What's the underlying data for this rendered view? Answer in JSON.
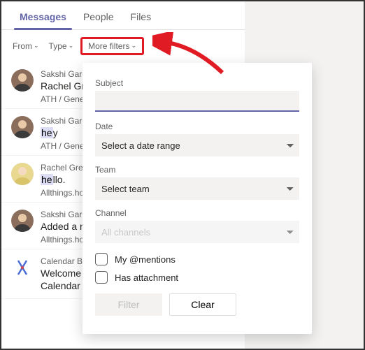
{
  "colors": {
    "accent": "#6264a7",
    "highlight_bg": "#dcdcf5",
    "annotation": "#e01b24"
  },
  "tabs": {
    "items": [
      "Messages",
      "People",
      "Files"
    ],
    "activeIndex": 0
  },
  "filters_row": {
    "from": "From",
    "type": "Type",
    "more": "More filters"
  },
  "results": [
    {
      "sender": "Sakshi Garg",
      "message_html": "Rachel Gre... <mark>he</mark>re.",
      "sub": "ATH / General",
      "avatar": "sakshi"
    },
    {
      "sender": "Sakshi Garg",
      "message_html": "<mark>he</mark>y",
      "sub": "ATH / General",
      "avatar": "sakshi"
    },
    {
      "sender": "Rachel Green",
      "message_html": "<mark>he</mark>llo.",
      "sub": "Allthings.howto",
      "avatar": "rachel"
    },
    {
      "sender": "Sakshi Garg",
      "message_html": "Added a new... channel. <mark>He</mark>...",
      "sub": "Allthings.howto",
      "avatar": "sakshi"
    },
    {
      "sender": "Calendar Bot",
      "message_html": "Welcome ...<br>Calendar Bot. I can <mark>he</mark>lp you view",
      "sub": "",
      "avatar": "calendar"
    }
  ],
  "panel": {
    "subject": {
      "label": "Subject",
      "value": ""
    },
    "date": {
      "label": "Date",
      "placeholder": "Select a date range"
    },
    "team": {
      "label": "Team",
      "placeholder": "Select team"
    },
    "channel": {
      "label": "Channel",
      "placeholder": "All channels"
    },
    "mentions": "My @mentions",
    "attach": "Has attachment",
    "filter_btn": "Filter",
    "clear_btn": "Clear"
  }
}
